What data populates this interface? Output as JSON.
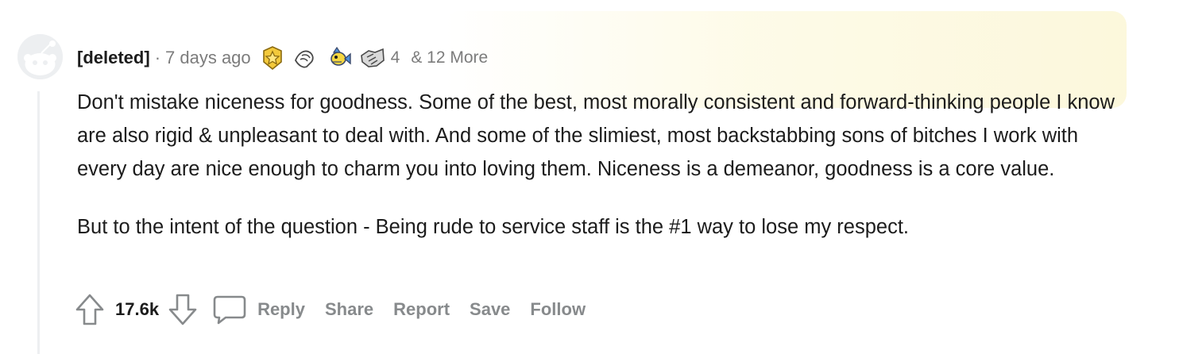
{
  "comment": {
    "author": "[deleted]",
    "separator": "·",
    "time_ago": "7 days ago",
    "awards": [
      {
        "icon": "gold-star-award-icon"
      },
      {
        "icon": "hands-award-icon"
      },
      {
        "icon": "fish-award-icon"
      },
      {
        "icon": "handshake-award-icon",
        "count": "4"
      }
    ],
    "awards_more": "& 12 More",
    "paragraphs": [
      "Don't mistake niceness for goodness. Some of the best, most morally consistent and forward-thinking people I know are also rigid & unpleasant to deal with. And some of the slimiest, most backstabbing sons of bitches I work with every day are nice enough to charm you into loving them. Niceness is a demeanor, goodness is a core value.",
      "But to the intent of the question - Being rude to service staff is the #1 way to lose my respect."
    ]
  },
  "actions": {
    "score": "17.6k",
    "reply": "Reply",
    "share": "Share",
    "report": "Report",
    "save": "Save",
    "follow": "Follow"
  },
  "colors": {
    "text": "#1c1c1c",
    "meta": "#7c7c7c",
    "action": "#878a8c",
    "thread_line": "#edeff1",
    "award_glow": "#fcf7da"
  }
}
